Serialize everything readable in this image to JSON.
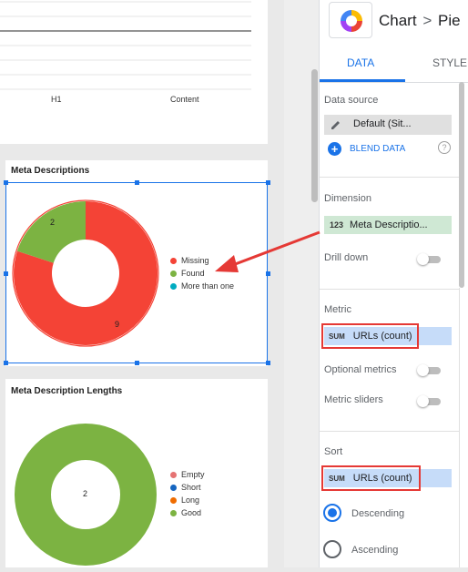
{
  "top_chart": {
    "x_labels": [
      "H1",
      "Content"
    ]
  },
  "meta_descriptions": {
    "title": "Meta Descriptions",
    "labels": {
      "found": "2",
      "missing": "9"
    },
    "legend": [
      {
        "label": "Missing",
        "color": "#f44336"
      },
      {
        "label": "Found",
        "color": "#7cb342"
      },
      {
        "label": "More than one",
        "color": "#00acc1"
      }
    ]
  },
  "meta_description_lengths": {
    "title": "Meta Description Lengths",
    "center_label": "2",
    "legend": [
      {
        "label": "Empty",
        "color": "#e57373"
      },
      {
        "label": "Short",
        "color": "#1565c0"
      },
      {
        "label": "Long",
        "color": "#ef6c00"
      },
      {
        "label": "Good",
        "color": "#7cb342"
      }
    ]
  },
  "panel": {
    "breadcrumb": {
      "root": "Chart",
      "sep": ">",
      "current": "Pie"
    },
    "tabs": [
      {
        "label": "DATA",
        "active": true
      },
      {
        "label": "STYLE",
        "active": false
      }
    ],
    "data_source": {
      "heading": "Data source",
      "value": "Default (Sit...",
      "blend_label": "BLEND DATA",
      "help_icon": "?"
    },
    "dimension": {
      "heading": "Dimension",
      "type": "123",
      "value": "Meta Descriptio...",
      "drill_down_label": "Drill down"
    },
    "metric": {
      "heading": "Metric",
      "agg": "SUM",
      "value": "URLs (count)",
      "optional_label": "Optional metrics",
      "sliders_label": "Metric sliders"
    },
    "sort": {
      "heading": "Sort",
      "agg": "SUM",
      "value": "URLs (count)",
      "options": [
        {
          "label": "Descending",
          "selected": true
        },
        {
          "label": "Ascending",
          "selected": false
        }
      ]
    }
  },
  "colors": {
    "accent": "#1a73e8",
    "annotation": "#e53935",
    "metric_chip": "#c6dcf9",
    "dimension_chip": "#cfe8d4",
    "source_chip": "#e0e0e0"
  }
}
